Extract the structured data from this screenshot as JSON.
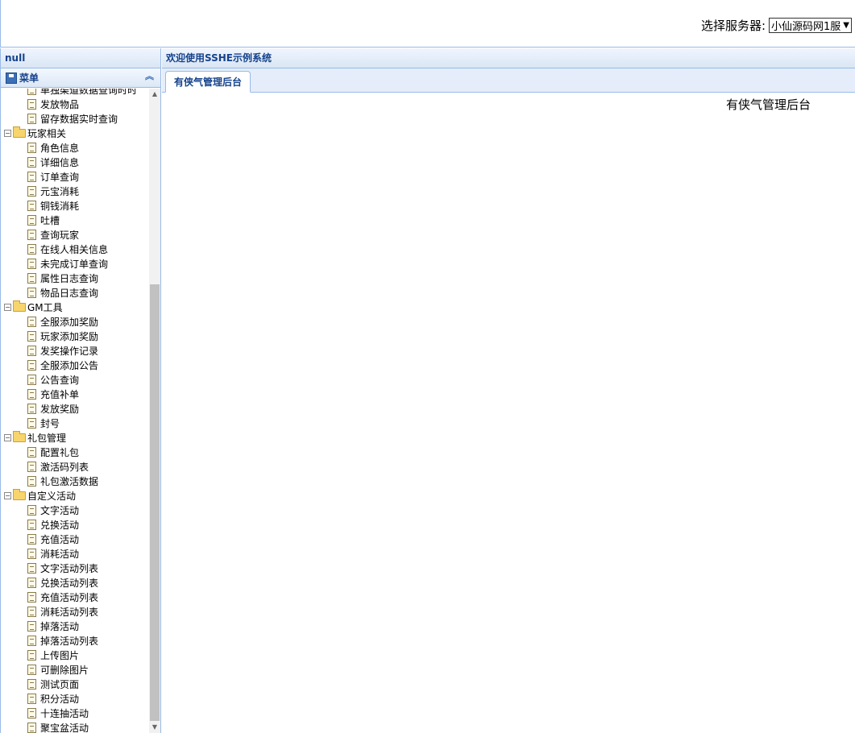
{
  "header": {
    "server_label": "选择服务器:",
    "server_selected": "小仙源码网1服"
  },
  "west": {
    "title": "null",
    "accordion_title": "菜单",
    "tree": [
      {
        "type": "leaf",
        "label": "单独渠道数据查询时时"
      },
      {
        "type": "leaf",
        "label": "发放物品"
      },
      {
        "type": "leaf",
        "label": "留存数据实时查询"
      },
      {
        "type": "folder",
        "label": "玩家相关"
      },
      {
        "type": "leaf",
        "label": "角色信息"
      },
      {
        "type": "leaf",
        "label": "详细信息"
      },
      {
        "type": "leaf",
        "label": "订单查询"
      },
      {
        "type": "leaf",
        "label": "元宝消耗"
      },
      {
        "type": "leaf",
        "label": "铜钱消耗"
      },
      {
        "type": "leaf",
        "label": "吐槽"
      },
      {
        "type": "leaf",
        "label": "查询玩家"
      },
      {
        "type": "leaf",
        "label": "在线人相关信息"
      },
      {
        "type": "leaf",
        "label": "未完成订单查询"
      },
      {
        "type": "leaf",
        "label": "属性日志查询"
      },
      {
        "type": "leaf",
        "label": "物品日志查询"
      },
      {
        "type": "folder",
        "label": "GM工具"
      },
      {
        "type": "leaf",
        "label": "全服添加奖励"
      },
      {
        "type": "leaf",
        "label": "玩家添加奖励"
      },
      {
        "type": "leaf",
        "label": "发奖操作记录"
      },
      {
        "type": "leaf",
        "label": "全服添加公告"
      },
      {
        "type": "leaf",
        "label": "公告查询"
      },
      {
        "type": "leaf",
        "label": "充值补单"
      },
      {
        "type": "leaf",
        "label": "发放奖励"
      },
      {
        "type": "leaf",
        "label": "封号"
      },
      {
        "type": "folder",
        "label": "礼包管理"
      },
      {
        "type": "leaf",
        "label": "配置礼包"
      },
      {
        "type": "leaf",
        "label": "激活码列表"
      },
      {
        "type": "leaf",
        "label": "礼包激活数据"
      },
      {
        "type": "folder",
        "label": "自定义活动"
      },
      {
        "type": "leaf",
        "label": "文字活动"
      },
      {
        "type": "leaf",
        "label": "兑换活动"
      },
      {
        "type": "leaf",
        "label": "充值活动"
      },
      {
        "type": "leaf",
        "label": "消耗活动"
      },
      {
        "type": "leaf",
        "label": "文字活动列表"
      },
      {
        "type": "leaf",
        "label": "兑换活动列表"
      },
      {
        "type": "leaf",
        "label": "充值活动列表"
      },
      {
        "type": "leaf",
        "label": "消耗活动列表"
      },
      {
        "type": "leaf",
        "label": "掉落活动"
      },
      {
        "type": "leaf",
        "label": "掉落活动列表"
      },
      {
        "type": "leaf",
        "label": "上传图片"
      },
      {
        "type": "leaf",
        "label": "可删除图片"
      },
      {
        "type": "leaf",
        "label": "测试页面"
      },
      {
        "type": "leaf",
        "label": "积分活动"
      },
      {
        "type": "leaf",
        "label": "十连抽活动"
      },
      {
        "type": "leaf",
        "label": "聚宝盆活动"
      }
    ]
  },
  "center": {
    "title": "欢迎使用SSHE示例系统",
    "tab_label": "有侠气管理后台",
    "content_title": "有侠气管理后台"
  },
  "icons": {
    "menu": "floppy-disk-icon",
    "collapse": "double-chevron-up-icon",
    "folder": "folder-open-icon",
    "leaf": "page-icon"
  }
}
